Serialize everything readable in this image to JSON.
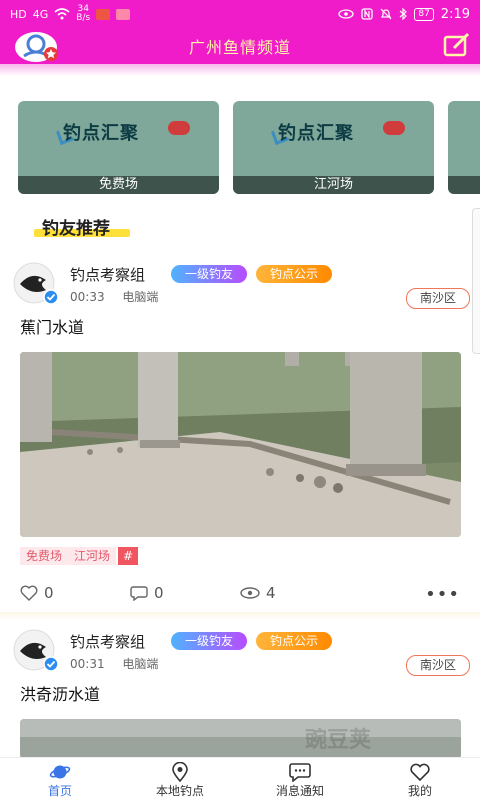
{
  "status_bar": {
    "left_items": [
      "HD",
      "4G",
      "34",
      "B/s"
    ],
    "battery": "87",
    "time": "2:19"
  },
  "header": {
    "title": "广州鱼情频道"
  },
  "categories": [
    {
      "banner": "钓点汇聚",
      "caption": "免费场"
    },
    {
      "banner": "钓点汇聚",
      "caption": "江河场"
    }
  ],
  "section": {
    "title": "钓友推荐"
  },
  "posts": [
    {
      "author": "钓点考察组",
      "level_tag": "一级钓友",
      "notice_tag": "钓点公示",
      "time": "00:33",
      "client": "电脑端",
      "area": "南沙区",
      "title": "蕉门水道",
      "tags": [
        "免费场",
        "江河场",
        "#"
      ],
      "likes": "0",
      "comments": "0",
      "views": "4"
    },
    {
      "author": "钓点考察组",
      "level_tag": "一级钓友",
      "notice_tag": "钓点公示",
      "time": "00:31",
      "client": "电脑端",
      "area": "南沙区",
      "title": "洪奇沥水道"
    }
  ],
  "bottom_nav": [
    {
      "label": "首页",
      "icon": "planet-icon",
      "active": true
    },
    {
      "label": "本地钓点",
      "icon": "location-pin-icon",
      "active": false
    },
    {
      "label": "消息通知",
      "icon": "chat-bubble-icon",
      "active": false
    },
    {
      "label": "我的",
      "icon": "heart-chat-icon",
      "active": false
    }
  ],
  "watermark": "豌豆荚",
  "colors": {
    "header_bg": "#f01bc9",
    "title_color": "#fff7a8",
    "active_nav": "#3b74e6",
    "area_border": "#ef7755"
  }
}
